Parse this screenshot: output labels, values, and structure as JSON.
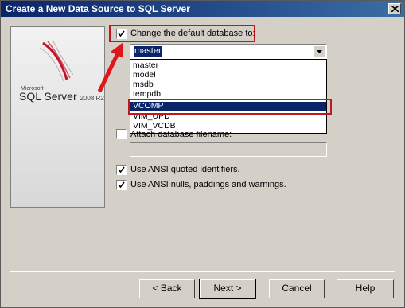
{
  "window": {
    "title": "Create a New Data Source to SQL Server"
  },
  "logo": {
    "microsoft": "Microsoft",
    "product": "SQL Server",
    "version": "2008 R2"
  },
  "options": {
    "change_default_db": "Change the default database to:",
    "change_default_db_checked": true,
    "attach_db": "Attach database filename:",
    "attach_db_checked": false,
    "ansi_quoted": "Use ANSI quoted identifiers.",
    "ansi_quoted_checked": true,
    "ansi_nulls": "Use ANSI nulls, paddings and warnings.",
    "ansi_nulls_checked": true
  },
  "database_select": {
    "value": "master",
    "options": [
      "master",
      "model",
      "msdb",
      "tempdb",
      "VCOMP",
      "VIM_UPD",
      "VIM_VCDB"
    ],
    "selected_option": "VCOMP"
  },
  "buttons": {
    "back": "< Back",
    "next": "Next >",
    "cancel": "Cancel",
    "help": "Help"
  },
  "colors": {
    "highlight_red": "#c0161c",
    "selection_blue": "#0a246a",
    "dialog_gray": "#d4d0c8"
  }
}
